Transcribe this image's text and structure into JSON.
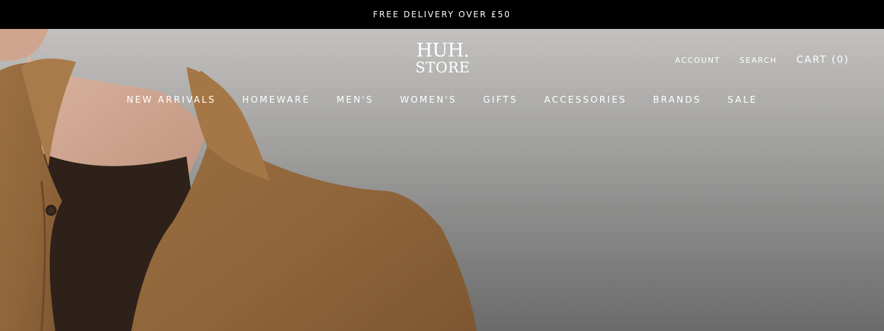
{
  "announcement": {
    "text": "FREE DELIVERY OVER £50"
  },
  "logo": {
    "line1": "HUH.",
    "line2": "STORE"
  },
  "header_links": {
    "account": "ACCOUNT",
    "search": "SEARCH",
    "cart": "CART (0)"
  },
  "nav": {
    "items": [
      {
        "label": "NEW ARRIVALS"
      },
      {
        "label": "HOMEWARE"
      },
      {
        "label": "MEN'S"
      },
      {
        "label": "WOMEN'S"
      },
      {
        "label": "GIFTS"
      },
      {
        "label": "ACCESSORIES"
      },
      {
        "label": "BRANDS"
      },
      {
        "label": "SALE"
      }
    ]
  },
  "colors": {
    "announcement_bg": "#000000",
    "text": "#ffffff",
    "jacket": "#946a3e",
    "sweater": "#2e2119"
  }
}
